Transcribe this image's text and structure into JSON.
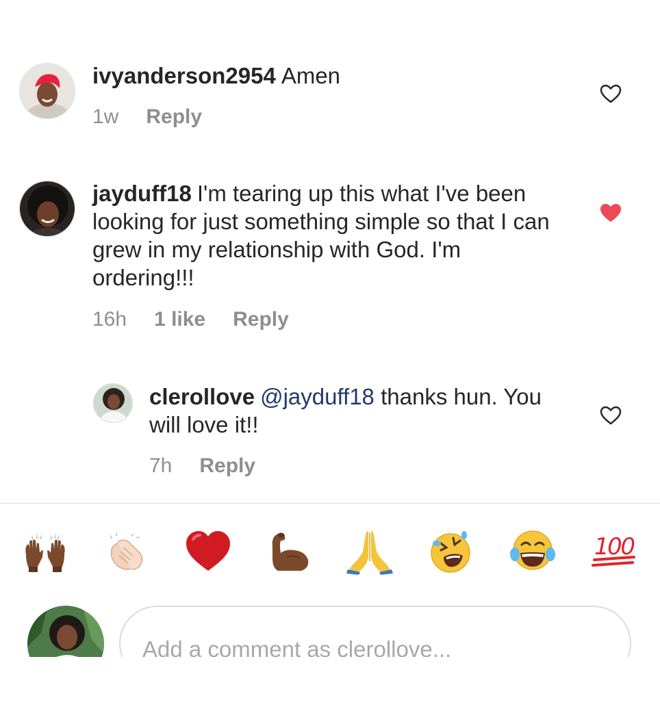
{
  "comments": [
    {
      "username": "ivyanderson2954",
      "text": "Amen",
      "time": "1w",
      "reply": "Reply",
      "liked": false
    },
    {
      "username": "jayduff18",
      "text": "I'm tearing up this what I've been looking for just something simple so that I can grew in my relationship with God. I'm ordering!!!",
      "time": "16h",
      "likes": "1 like",
      "reply": "Reply",
      "liked": true
    }
  ],
  "reply_comment": {
    "username": "clerollove",
    "mention": "@jayduff18",
    "text": "thanks hun. You will love it!!",
    "time": "7h",
    "reply": "Reply",
    "liked": false
  },
  "emoji_bar": [
    {
      "icon": "raising-hands-icon",
      "char": "🙌🏾"
    },
    {
      "icon": "clapping-hands-icon",
      "char": "👏🏻"
    },
    {
      "icon": "red-heart-icon",
      "char": "❤️"
    },
    {
      "icon": "flexed-biceps-icon",
      "char": "💪🏾"
    },
    {
      "icon": "folded-hands-icon",
      "char": "🙏"
    },
    {
      "icon": "rolling-laughing-icon",
      "char": "🤣"
    },
    {
      "icon": "tears-of-joy-icon",
      "char": "😂"
    },
    {
      "icon": "hundred-points-icon",
      "char": "💯"
    }
  ],
  "composer": {
    "placeholder": "Add a comment as clerollove..."
  },
  "colors": {
    "like_red": "#ed4956",
    "muted": "#8e8e8e",
    "mention": "#1f3a6b",
    "divider": "#dbdbdb"
  }
}
